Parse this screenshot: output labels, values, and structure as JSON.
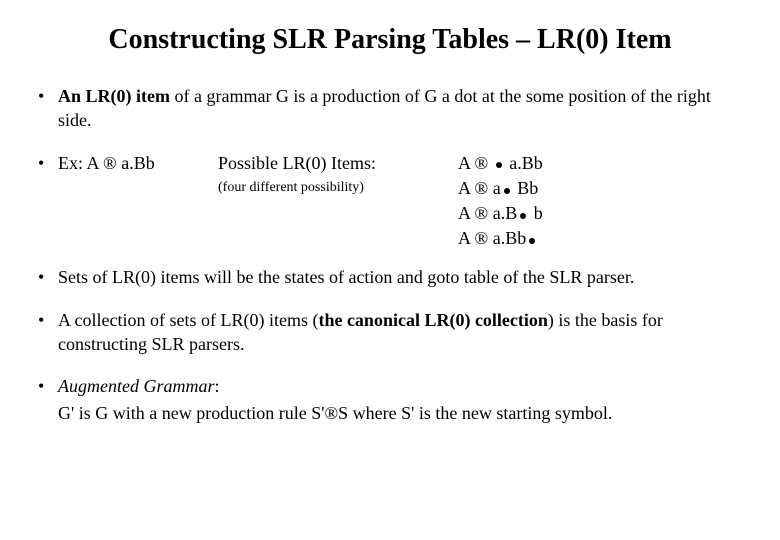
{
  "title": "Constructing SLR Parsing Tables – LR(0) Item",
  "bullet1_prefix_bold": "An LR(0) item",
  "bullet1_rest": " of a grammar G is a production of G a dot at the some position of the right side.",
  "ex_label": "Ex:   A ",
  "ex_rhs": " a.Bb",
  "possible_label": "Possible LR(0) Items:",
  "four_note": "(four different possibility)",
  "arrow": "®",
  "items_A": "A ",
  "rhs0": " a.Bb",
  "rhs1_pre": " a",
  "rhs1_post": " Bb",
  "rhs2_pre": " a.B",
  "rhs2_post": " b",
  "rhs3_pre": " a.Bb",
  "bullet3": "Sets of LR(0) items will be the states of action and goto table of the SLR parser.",
  "bullet4_pre": "A collection of sets of LR(0) items (",
  "bullet4_bold": "the canonical LR(0) collection",
  "bullet4_post": ") is the basis  for constructing SLR parsers.",
  "aug_label": "Augmented Grammar",
  "aug_colon": ":",
  "aug_body_pre": "G' is G with a new production rule S'",
  "aug_body_post": "S where S' is the new starting symbol."
}
